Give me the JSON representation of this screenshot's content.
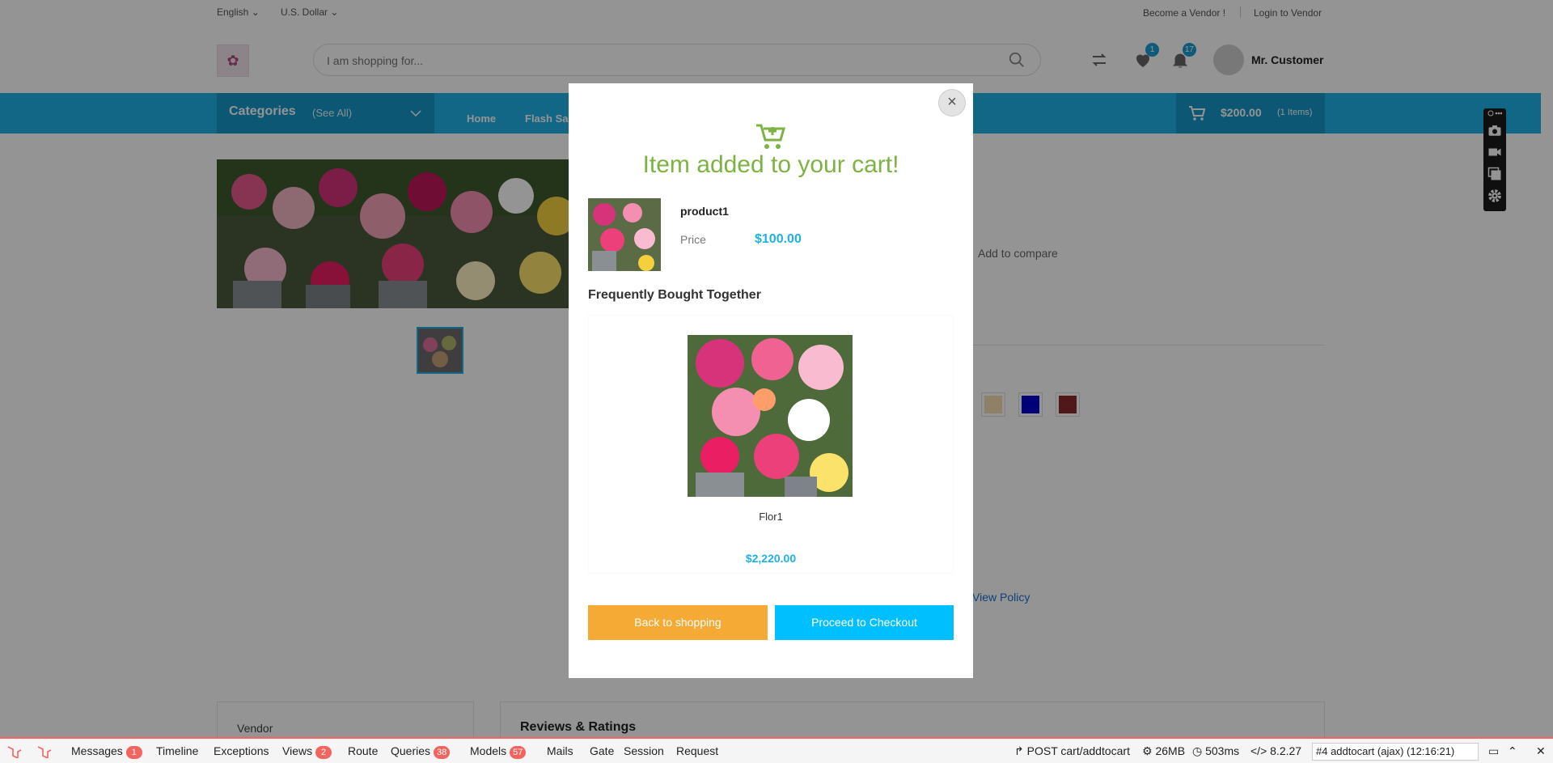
{
  "topbar": {
    "language": "English",
    "currency": "U.S. Dollar",
    "become_vendor": "Become a Vendor !",
    "login_vendor": "Login to Vendor"
  },
  "header": {
    "search_placeholder": "I am shopping for...",
    "wishlist_count": "1",
    "notifications_count": "17",
    "user_name": "Mr. Customer"
  },
  "nav": {
    "categories": "Categories",
    "see_all": "(See All)",
    "links": [
      "Home",
      "Flash Sa"
    ],
    "cart_total": "$200.00",
    "cart_items": "(1 Items)"
  },
  "product": {
    "add_to_compare": "Add to compare",
    "view_policy": "View Policy",
    "swatch_colors": [
      "#f5deb3",
      "#0000cd",
      "#8b2a2a"
    ]
  },
  "below": {
    "vendor": "Vendor",
    "reviews": "Reviews & Ratings"
  },
  "modal": {
    "title": "Item added to your cart!",
    "product_name": "product1",
    "price_label": "Price",
    "price": "$100.00",
    "fbt_heading": "Frequently Bought Together",
    "fbt_item": {
      "name": "Flor1",
      "price": "$2,220.00"
    },
    "back_button": "Back to shopping",
    "checkout_button": "Proceed to Checkout",
    "close": "×"
  },
  "debugbar": {
    "items": [
      {
        "label": "Messages",
        "count": "1"
      },
      {
        "label": "Timeline"
      },
      {
        "label": "Exceptions"
      },
      {
        "label": "Views",
        "count": "2"
      },
      {
        "label": "Route"
      },
      {
        "label": "Queries",
        "count": "38"
      },
      {
        "label": "Models",
        "count": "57"
      },
      {
        "label": "Mails"
      },
      {
        "label": "Gate"
      },
      {
        "label": "Session"
      },
      {
        "label": "Request"
      }
    ],
    "request": "POST cart/addtocart",
    "memory": "26MB",
    "time": "503ms",
    "php": "8.2.27",
    "selected_request": "#4 addtocart (ajax) (12:16:21)"
  },
  "colors": {
    "primary": "#1eb1e6",
    "primary_dark": "#1698c8",
    "success": "#7cb342",
    "warning": "#f4aa35",
    "checkout": "#00bfff",
    "debug_accent": "#f4645f"
  }
}
